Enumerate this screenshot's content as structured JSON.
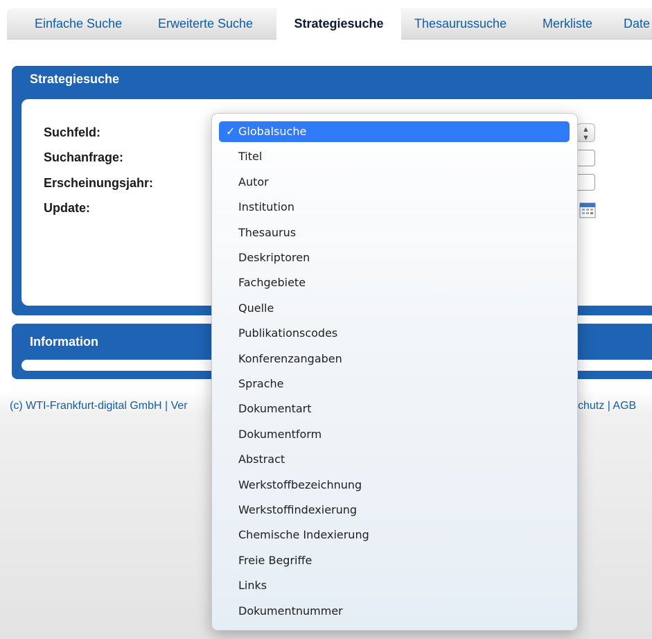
{
  "tabs": [
    {
      "label": "Einfache Suche"
    },
    {
      "label": "Erweiterte Suche"
    },
    {
      "label": "Strategiesuche"
    },
    {
      "label": "Thesaurussuche"
    },
    {
      "label": "Merkliste"
    },
    {
      "label": "Date"
    }
  ],
  "active_tab": "Strategiesuche",
  "strategy_panel": {
    "title": "Strategiesuche",
    "labels": {
      "search_field": "Suchfeld:",
      "query": "Suchanfrage:",
      "year": "Erscheinungsjahr:",
      "update": "Update:"
    }
  },
  "info_panel": {
    "title": "Information"
  },
  "footer": {
    "left": "(c) WTI-Frankfurt-digital GmbH | Ver",
    "right": "chutz | AGB"
  },
  "dropdown": {
    "selected_index": 0,
    "check_glyph": "✓",
    "options": [
      "Globalsuche",
      "Titel",
      "Autor",
      "Institution",
      "Thesaurus",
      "Deskriptoren",
      "Fachgebiete",
      "Quelle",
      "Publikationscodes",
      "Konferenzangaben",
      "Sprache",
      "Dokumentart",
      "Dokumentform",
      "Abstract",
      "Werkstoffbezeichnung",
      "Werkstoffindexierung",
      "Chemische Indexierung",
      "Freie Begriffe",
      "Links",
      "Dokumentnummer"
    ]
  },
  "icons": {
    "stepper": "updown-arrows-icon",
    "update_picker": "calendar-icon"
  },
  "colors": {
    "panel_header": "#1e63b4",
    "link": "#0e5da8",
    "menu_selected": "#2f7af6"
  }
}
